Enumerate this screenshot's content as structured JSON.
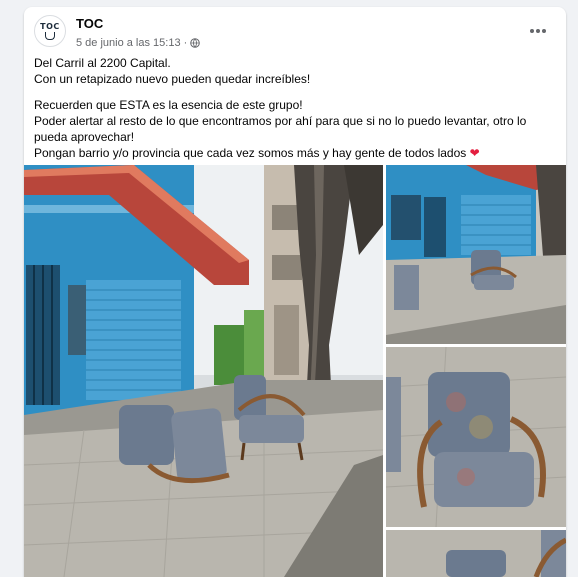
{
  "post": {
    "author": "TOC",
    "avatar_text": "TOC",
    "timestamp": "5 de junio a las 15:13",
    "separator": "·",
    "privacy_icon": "globe-icon",
    "more_icon": "more-options-icon"
  },
  "content": {
    "line1": "Del Carril al 2200 Capital.",
    "line2": "Con un retapizado nuevo pueden quedar increíbles!",
    "line3": "Recuerden que ESTA es la esencia de este grupo!",
    "line4": "Poder alertar al resto de lo que encontramos por ahí para que si no lo puedo levantar, otro lo pueda aprovechar!",
    "line5": "Pongan barrio y/o provincia que cada vez somos más y hay gente de todos lados",
    "heart": "❤"
  },
  "photos": [
    {
      "name": "photo-street-armchairs"
    },
    {
      "name": "photo-armchair-sidewalk"
    },
    {
      "name": "photo-armchair-closeup"
    },
    {
      "name": "photo-armchair-partial"
    }
  ],
  "colors": {
    "wall_blue": "#2f8fc4",
    "awning_red": "#c0392b",
    "upholstery": "#6b7a8f",
    "wood": "#8a5a32",
    "sidewalk": "#b9b6ae"
  }
}
